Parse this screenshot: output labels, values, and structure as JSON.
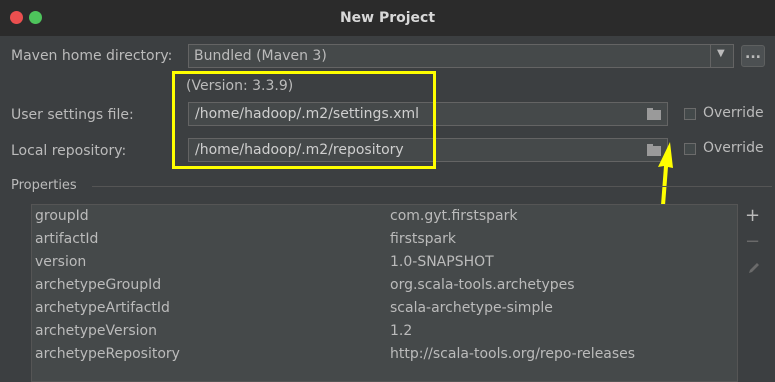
{
  "window": {
    "title": "New Project"
  },
  "maven_home": {
    "label": "Maven home directory:",
    "value": "Bundled (Maven 3)",
    "browse_label": "...",
    "version": "(Version: 3.3.9)"
  },
  "user_settings": {
    "label": "User settings file:",
    "value": "/home/hadoop/.m2/settings.xml",
    "override_label": "Override"
  },
  "local_repo": {
    "label": "Local repository:",
    "value": "/home/hadoop/.m2/repository",
    "override_label": "Override"
  },
  "properties": {
    "label": "Properties",
    "rows": [
      {
        "key": "groupId",
        "value": "com.gyt.firstspark"
      },
      {
        "key": "artifactId",
        "value": "firstspark"
      },
      {
        "key": "version",
        "value": "1.0-SNAPSHOT"
      },
      {
        "key": "archetypeGroupId",
        "value": "org.scala-tools.archetypes"
      },
      {
        "key": "archetypeArtifactId",
        "value": "scala-archetype-simple"
      },
      {
        "key": "archetypeVersion",
        "value": "1.2"
      },
      {
        "key": "archetypeRepository",
        "value": "http://scala-tools.org/repo-releases"
      }
    ],
    "add_label": "+",
    "remove_label": "−"
  },
  "colors": {
    "background": "#3c3f41",
    "highlight": "#ffff00"
  }
}
